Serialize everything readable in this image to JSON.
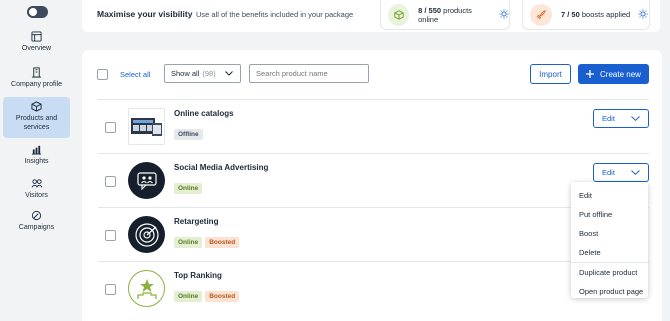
{
  "sidebar": {
    "items": [
      {
        "label": "Overview",
        "icon": "overview-icon"
      },
      {
        "label": "Company profile",
        "icon": "building-icon"
      },
      {
        "label": "Products and services",
        "icon": "cube-icon"
      },
      {
        "label": "Insights",
        "icon": "chart-icon"
      },
      {
        "label": "Visitors",
        "icon": "users-icon"
      },
      {
        "label": "Campaigns",
        "icon": "rocket-icon"
      }
    ],
    "active_index": 2
  },
  "topbar": {
    "title": "Maximise your visibility",
    "subtitle": "Use all of the benefits included in your package",
    "products_online": "8 / 550",
    "products_online_label": "products online",
    "boosts_applied": "7 / 50",
    "boosts_applied_label": "boosts applied"
  },
  "toolbar": {
    "select_all": "Select all",
    "filter_value": "Show all",
    "filter_count": "(98)",
    "search_placeholder": "Search product name",
    "import_label": "Import",
    "create_label": "Create new"
  },
  "products": [
    {
      "name": "Online catalogs",
      "badges": [
        "Offline"
      ],
      "edit_label": "Edit"
    },
    {
      "name": "Social Media Advertising",
      "badges": [
        "Online"
      ],
      "edit_label": "Edit"
    },
    {
      "name": "Retargeting",
      "badges": [
        "Online",
        "Boosted"
      ],
      "edit_label": "Edit"
    },
    {
      "name": "Top Ranking",
      "badges": [
        "Online",
        "Boosted"
      ],
      "edit_label": "Edit"
    }
  ],
  "dropdown": {
    "items": [
      "Edit",
      "Put offline",
      "Boost",
      "Delete"
    ],
    "items_secondary": [
      "Duplicate product",
      "Open product page"
    ]
  },
  "colors": {
    "accent": "#1a5fd0",
    "active_nav": "#c8dcf4",
    "online_badge": "#e4eed3",
    "boosted_badge": "#fbe3d3"
  }
}
